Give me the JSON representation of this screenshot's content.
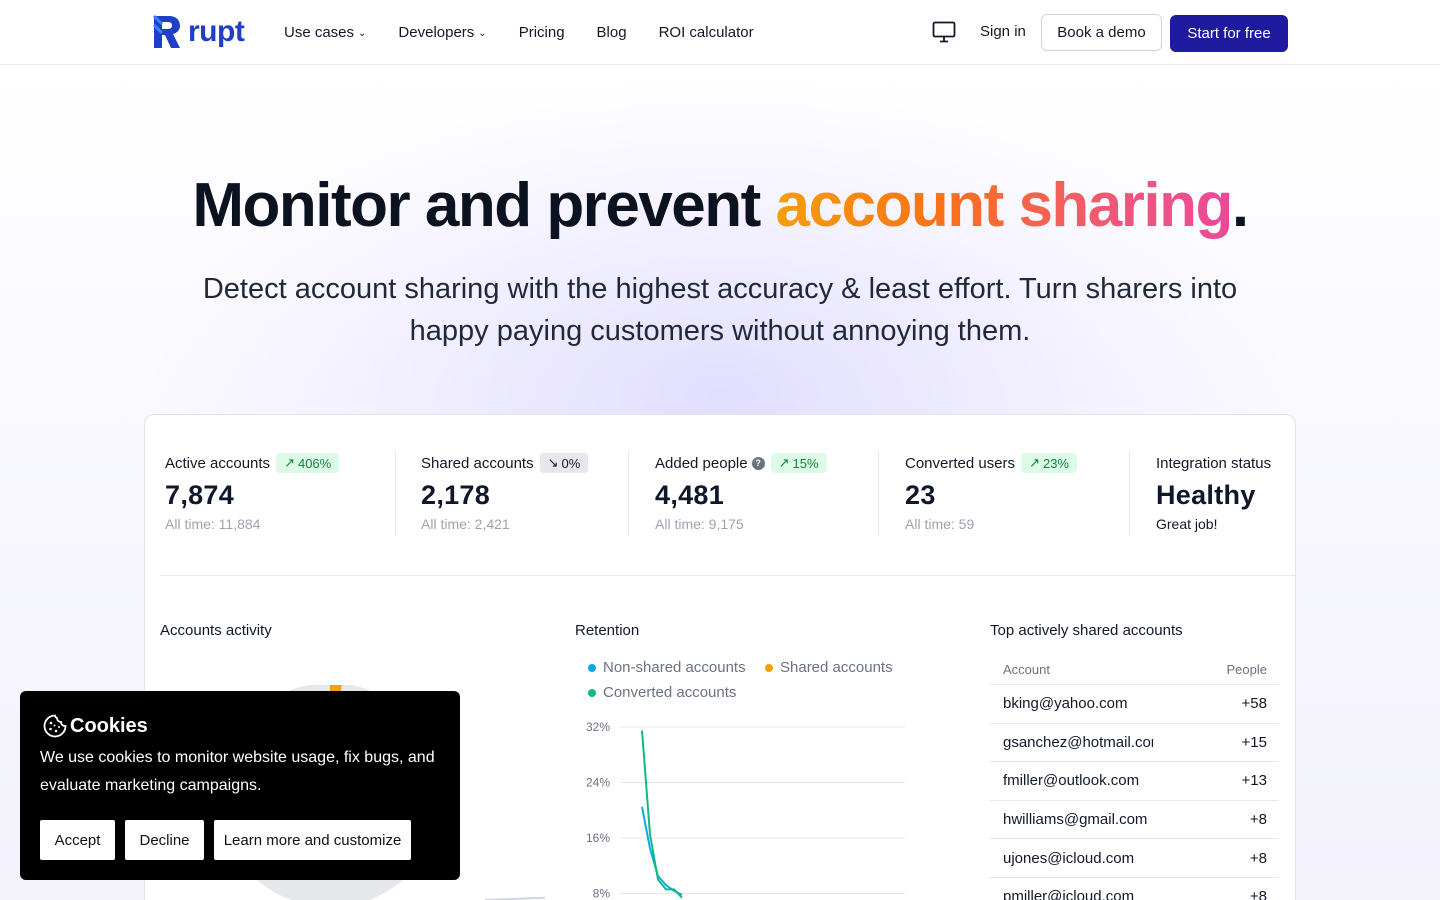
{
  "brand": {
    "name": "rupt",
    "color": "#1f3fc9"
  },
  "nav": {
    "items": [
      {
        "label": "Use cases",
        "dropdown": true
      },
      {
        "label": "Developers",
        "dropdown": true
      },
      {
        "label": "Pricing",
        "dropdown": false
      },
      {
        "label": "Blog",
        "dropdown": false
      },
      {
        "label": "ROI calculator",
        "dropdown": false
      }
    ],
    "sign_in": "Sign in",
    "book_demo": "Book a demo",
    "start_free": "Start for free",
    "icon": "monitor-icon"
  },
  "hero": {
    "title_main": "Monitor and prevent ",
    "title_highlight": "account sharing",
    "title_end": ".",
    "subtitle": "Detect account sharing with the highest accuracy & least effort. Turn sharers into happy paying customers without annoying them."
  },
  "stats": [
    {
      "label": "Active accounts",
      "badge": "406%",
      "trend": "up",
      "value": "7,874",
      "sub": "All time: 11,884"
    },
    {
      "label": "Shared accounts",
      "badge": "0%",
      "trend": "flat",
      "value": "2,178",
      "sub": "All time: 2,421"
    },
    {
      "label": "Added people",
      "badge": "15%",
      "trend": "up",
      "help": true,
      "value": "4,481",
      "sub": "All time: 9,175"
    },
    {
      "label": "Converted users",
      "badge": "23%",
      "trend": "up",
      "value": "23",
      "sub": "All time: 59"
    },
    {
      "label": "Integration status",
      "value": "Healthy",
      "sub": "Great job!"
    }
  ],
  "sections": {
    "activity": "Accounts activity",
    "retention": "Retention",
    "top_shared": "Top actively shared accounts"
  },
  "chart_data": {
    "type": "line",
    "title": "Retention",
    "yticks": [
      "32%",
      "24%",
      "16%",
      "8%"
    ],
    "ylim": [
      8,
      32
    ],
    "legend_position": "top",
    "series": [
      {
        "name": "Non-shared accounts",
        "color": "#0ea5e9",
        "values": [
          20.5,
          14.5,
          10.5,
          9.2,
          8.4,
          7.8
        ]
      },
      {
        "name": "Shared accounts",
        "color": "#f59e0b",
        "values": []
      },
      {
        "name": "Converted accounts",
        "color": "#10b981",
        "values": [
          31.5,
          16.5,
          10,
          8.6,
          8.6,
          7.4
        ]
      }
    ]
  },
  "top_shared": {
    "col_account": "Account",
    "col_people": "People",
    "rows": [
      {
        "account": "bking@yahoo.com",
        "people": "+58"
      },
      {
        "account": "gsanchez@hotmail.com",
        "people": "+15"
      },
      {
        "account": "fmiller@outlook.com",
        "people": "+13"
      },
      {
        "account": "hwilliams@gmail.com",
        "people": "+8"
      },
      {
        "account": "ujones@icloud.com",
        "people": "+8"
      },
      {
        "account": "pmiller@icloud.com",
        "people": "+8"
      }
    ]
  },
  "cookie": {
    "title": "Cookies",
    "text": "We use cookies to monitor website usage, fix bugs, and evaluate marketing campaigns.",
    "accept": "Accept",
    "decline": "Decline",
    "customize": "Learn more and customize",
    "icon": "cookie-icon"
  }
}
